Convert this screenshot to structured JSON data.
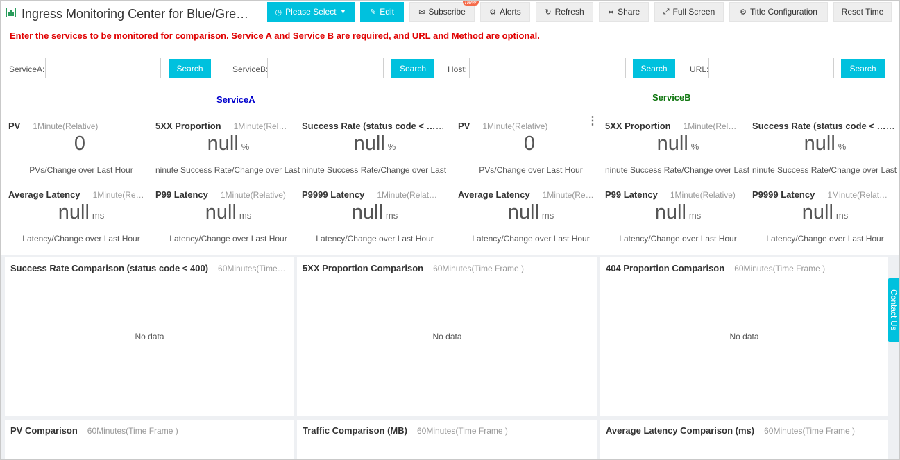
{
  "header": {
    "title": "Ingress Monitoring Center for Blue/Gre…",
    "buttons": {
      "please_select": "Please Select",
      "edit": "Edit",
      "subscribe": "Subscribe",
      "new_badge": "new",
      "alerts": "Alerts",
      "refresh": "Refresh",
      "share": "Share",
      "full_screen": "Full Screen",
      "title_config": "Title Configuration",
      "reset_time": "Reset Time"
    }
  },
  "filter": {
    "hint": "Enter the services to be monitored for comparison. Service A and Service B are required, and URL and Method are optional.",
    "service_a_label": "ServiceA:",
    "service_b_label": "ServiceB:",
    "host_label": "Host:",
    "url_label": "URL:",
    "search_label": "Search",
    "service_a_value": "",
    "service_b_value": "",
    "host_value": "",
    "url_value": ""
  },
  "sections": {
    "service_a": "ServiceA",
    "service_b": "ServiceB",
    "service_a_color": "#0000cc",
    "service_b_color": "#117711"
  },
  "metrics_a": [
    {
      "title": "PV",
      "tf": "1Minute(Relative)",
      "value": "0",
      "unit": "",
      "desc": "PVs/Change over Last Hour"
    },
    {
      "title": "5XX Proportion",
      "tf": "1Minute(Rel…",
      "value": "null",
      "unit": "%",
      "desc": "ninute Success Rate/Change over Last H"
    },
    {
      "title": "Success Rate (status code < …",
      "tf": "",
      "value": "null",
      "unit": "%",
      "desc": "ninute Success Rate/Change over Last H"
    },
    {
      "title": "Average Latency",
      "tf": "1Minute(Re…",
      "value": "null",
      "unit": "ms",
      "desc": "Latency/Change over Last Hour"
    },
    {
      "title": "P99 Latency",
      "tf": "1Minute(Relative)",
      "value": "null",
      "unit": "ms",
      "desc": "Latency/Change over Last Hour"
    },
    {
      "title": "P9999 Latency",
      "tf": "1Minute(Relat…",
      "value": "null",
      "unit": "ms",
      "desc": "Latency/Change over Last Hour"
    }
  ],
  "metrics_b": [
    {
      "title": "PV",
      "tf": "1Minute(Relative)",
      "value": "0",
      "unit": "",
      "desc": "PVs/Change over Last Hour"
    },
    {
      "title": "5XX Proportion",
      "tf": "1Minute(Rel…",
      "value": "null",
      "unit": "%",
      "desc": "ninute Success Rate/Change over Last H"
    },
    {
      "title": "Success Rate (status code < …",
      "tf": "",
      "value": "null",
      "unit": "%",
      "desc": "ninute Success Rate/Change over Last H"
    },
    {
      "title": "Average Latency",
      "tf": "1Minute(Re…",
      "value": "null",
      "unit": "ms",
      "desc": "Latency/Change over Last Hour"
    },
    {
      "title": "P99 Latency",
      "tf": "1Minute(Relative)",
      "value": "null",
      "unit": "ms",
      "desc": "Latency/Change over Last Hour"
    },
    {
      "title": "P9999 Latency",
      "tf": "1Minute(Relat…",
      "value": "null",
      "unit": "ms",
      "desc": "Latency/Change over Last Hour"
    }
  ],
  "panels": [
    {
      "title": "Success Rate Comparison (status code < 400)",
      "tf": "60Minutes(Time…",
      "nodata": "No data"
    },
    {
      "title": "5XX Proportion Comparison",
      "tf": "60Minutes(Time Frame )",
      "nodata": "No data"
    },
    {
      "title": "404 Proportion Comparison",
      "tf": "60Minutes(Time Frame )",
      "nodata": "No data"
    },
    {
      "title": "PV Comparison",
      "tf": "60Minutes(Time Frame )",
      "nodata": ""
    },
    {
      "title": "Traffic Comparison (MB)",
      "tf": "60Minutes(Time Frame )",
      "nodata": ""
    },
    {
      "title": "Average Latency Comparison (ms)",
      "tf": "60Minutes(Time Frame )",
      "nodata": ""
    }
  ],
  "contact": "Contact Us",
  "icons": {
    "dashboard": "dashboard-icon",
    "clock": "clock-icon",
    "edit": "edit-icon",
    "mail": "mail-icon",
    "bell": "bell-icon",
    "refresh": "refresh-icon",
    "share": "share-icon",
    "fullscreen": "fullscreen-icon",
    "gear": "gear-icon"
  }
}
